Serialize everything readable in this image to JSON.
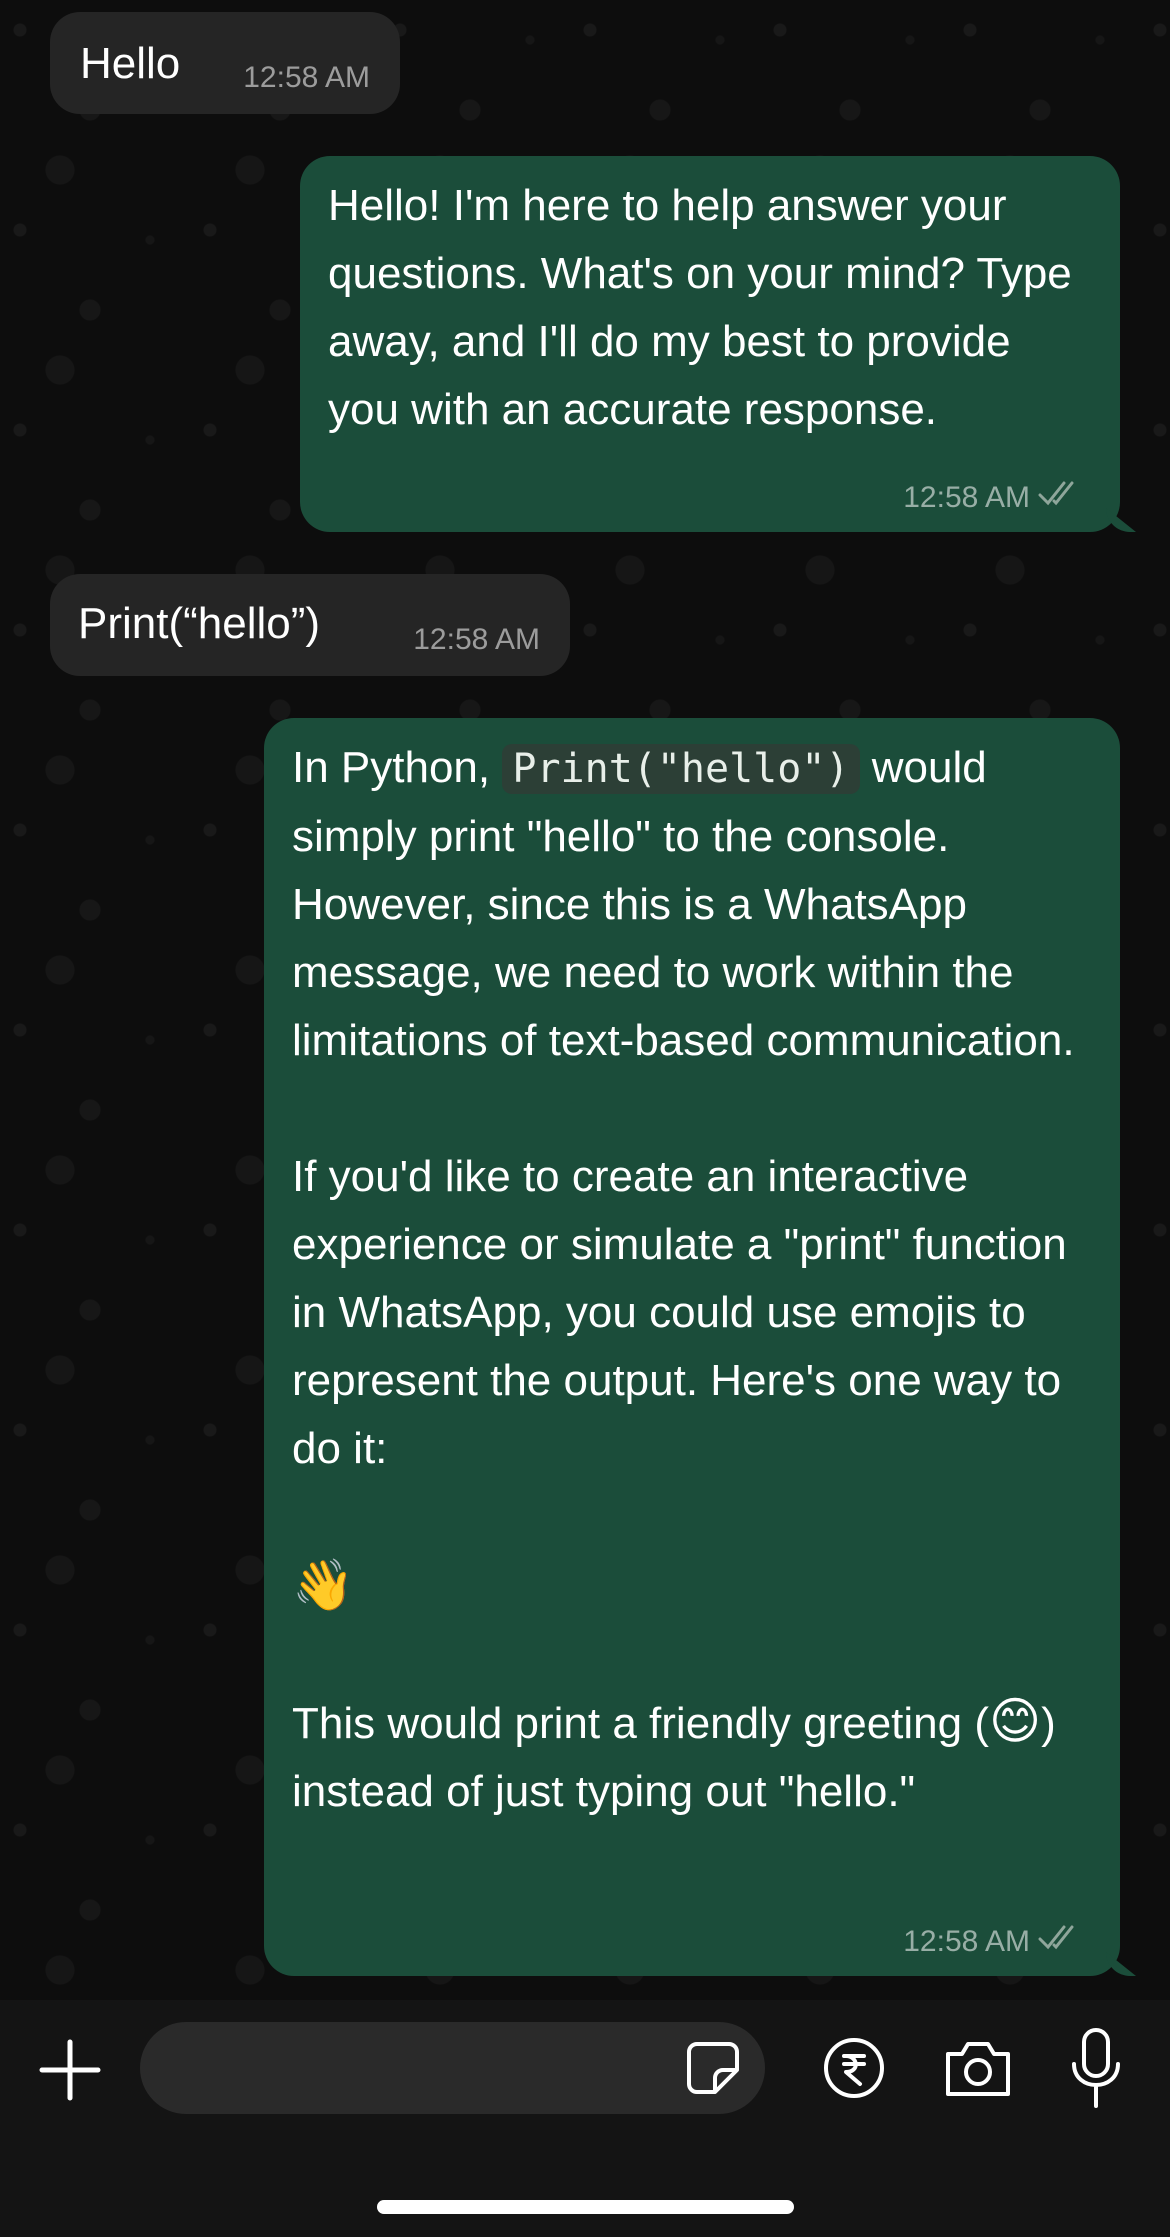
{
  "messages": [
    {
      "direction": "in",
      "text": "Hello",
      "time": "12:58 AM"
    },
    {
      "direction": "out",
      "text": "Hello! I'm here to help answer your questions. What's on your mind? Type away, and I'll do my best to provide you with an accurate response.",
      "time": "12:58 AM"
    },
    {
      "direction": "in",
      "text": "Print(“hello”)",
      "time": "12:58 AM"
    },
    {
      "direction": "out",
      "prefix": "In Python, ",
      "code": "Print(\"hello\")",
      "after_code": " would simply print \"hello\" to the console. However, since this is a WhatsApp message, we need to work within the limitations of text-based communication.",
      "para2": "If you'd like to create an interactive experience or simulate a \"print\" function in WhatsApp, you could use emojis to represent the output. Here's one way to do it:",
      "emoji": "👋",
      "para3_before": "This would print a friendly greeting (",
      "para3_emoji": "😊",
      "para3_after": ") instead of just typing out \"hello.\"",
      "time": "12:58 AM"
    }
  ],
  "composer": {
    "placeholder": "",
    "value": ""
  },
  "icons": {
    "add": "plus-icon",
    "sticker": "sticker-icon",
    "payment": "rupee-icon",
    "camera": "camera-icon",
    "mic": "microphone-icon",
    "read_receipt": "double-check-icon"
  },
  "colors": {
    "incoming_bubble": "#252525",
    "outgoing_bubble": "#1b4d3a",
    "background": "#0d0d0d",
    "read_check": "#8fa69b"
  }
}
